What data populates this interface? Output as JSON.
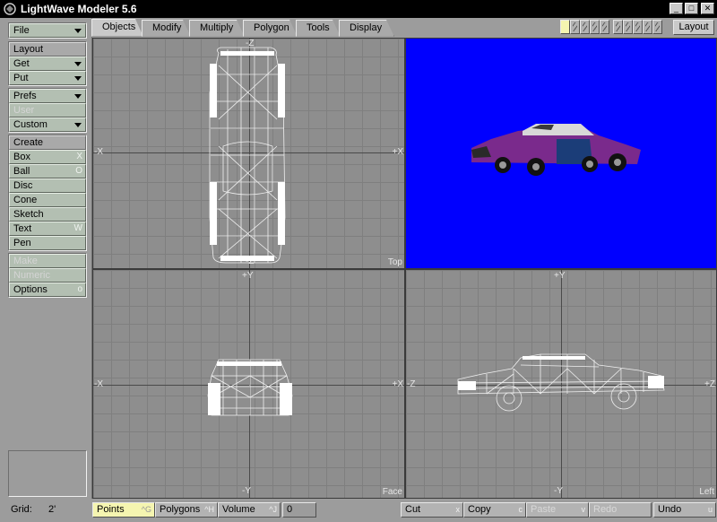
{
  "window": {
    "title": "LightWave Modeler 5.6",
    "min": "_",
    "max": "□",
    "close": "✕"
  },
  "sidebar": {
    "file": "File",
    "layout_head": "Layout",
    "get": "Get",
    "put": "Put",
    "prefs": "Prefs",
    "user": "User",
    "custom": "Custom",
    "create_head": "Create",
    "create_items": [
      {
        "label": "Box",
        "shortcut": "X"
      },
      {
        "label": "Ball",
        "shortcut": "O"
      },
      {
        "label": "Disc",
        "shortcut": ""
      },
      {
        "label": "Cone",
        "shortcut": ""
      },
      {
        "label": "Sketch",
        "shortcut": ""
      },
      {
        "label": "Text",
        "shortcut": "W"
      },
      {
        "label": "Pen",
        "shortcut": ""
      }
    ],
    "make": "Make",
    "numeric": "Numeric",
    "options": "Options",
    "options_shortcut": "o"
  },
  "tabs": [
    {
      "label": "Objects",
      "active": true
    },
    {
      "label": "Modify",
      "active": false
    },
    {
      "label": "Multiply",
      "active": false
    },
    {
      "label": "Polygon",
      "active": false
    },
    {
      "label": "Tools",
      "active": false
    },
    {
      "label": "Display",
      "active": false
    }
  ],
  "layer_buttons": {
    "count": 10,
    "active_index": 0
  },
  "layout_button": "Layout",
  "viewports": {
    "top": {
      "name": "Top",
      "axis_top": "-Z",
      "axis_bottom": "-Z",
      "axis_left": "-X",
      "axis_right": "+X"
    },
    "perspective": {
      "background": "#0000ff"
    },
    "face": {
      "name": "Face",
      "axis_top": "+Y",
      "axis_bottom": "-Y",
      "axis_left": "-X",
      "axis_right": "+X"
    },
    "left": {
      "name": "Left",
      "axis_top": "+Y",
      "axis_bottom": "-Y",
      "axis_left": "-Z",
      "axis_right": "+Z"
    }
  },
  "status": {
    "grid_label": "Grid:",
    "grid_value": "2'",
    "points": "Points",
    "points_sc": "^G",
    "polygons": "Polygons",
    "polygons_sc": "^H",
    "volume": "Volume",
    "volume_sc": "^J",
    "count": "0",
    "cut": "Cut",
    "cut_sc": "x",
    "copy": "Copy",
    "copy_sc": "c",
    "paste": "Paste",
    "paste_sc": "v",
    "redo": "Redo",
    "redo_sc": "",
    "undo": "Undo",
    "undo_sc": "u"
  },
  "colors": {
    "accent_yellow": "#f5f5b0",
    "button_green": "#b3bfb2",
    "viewport_blue": "#0000ff",
    "wire": "#f2f2f2"
  }
}
